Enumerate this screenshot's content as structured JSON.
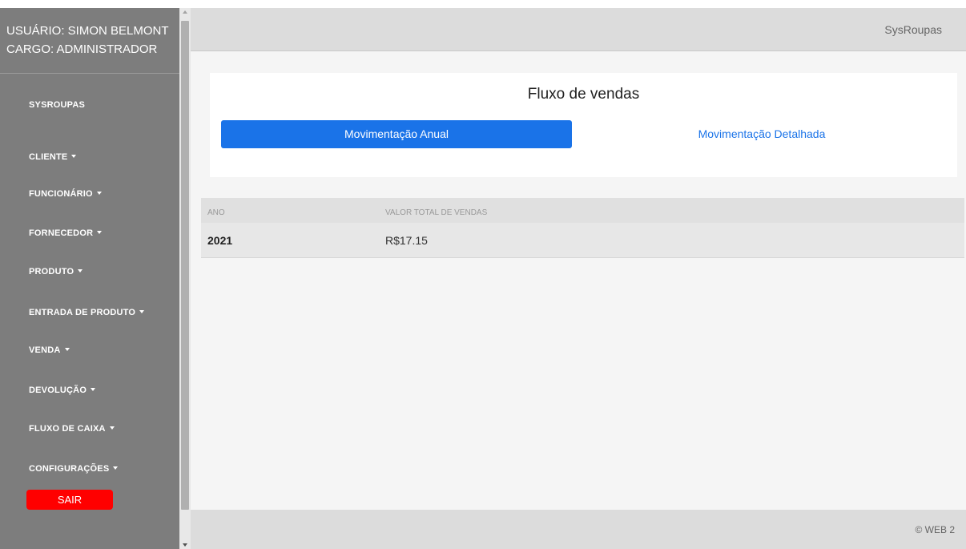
{
  "user": {
    "name_line": "USUÁRIO: SIMON BELMONT",
    "role_line": "CARGO: ADMINISTRADOR"
  },
  "sidebar": {
    "brand": "SYSROUPAS",
    "items": [
      {
        "label": "CLIENTE"
      },
      {
        "label": "FUNCIONÁRIO"
      },
      {
        "label": "FORNECEDOR"
      },
      {
        "label": "PRODUTO"
      },
      {
        "label": "ENTRADA DE PRODUTO"
      },
      {
        "label": "VENDA"
      },
      {
        "label": "DEVOLUÇÃO"
      },
      {
        "label": "FLUXO DE CAIXA"
      },
      {
        "label": "CONFIGURAÇÕES"
      }
    ],
    "logout_label": "SAIR"
  },
  "topbar": {
    "brand": "SysRoupas"
  },
  "card": {
    "title": "Fluxo de vendas",
    "tabs": [
      {
        "label": "Movimentação Anual",
        "active": true
      },
      {
        "label": "Movimentação Detalhada",
        "active": false
      }
    ]
  },
  "table": {
    "headers": [
      "ANO",
      "VALOR TOTAL DE VENDAS"
    ],
    "rows": [
      {
        "year": "2021",
        "total": "R$17.15"
      }
    ]
  },
  "footer": {
    "text": "© WEB 2"
  },
  "colors": {
    "sidebar_bg": "#7d7d7d",
    "accent": "#1a73e8",
    "logout": "#ff0000"
  },
  "icons": {
    "dropdown": "caret-down-icon"
  }
}
